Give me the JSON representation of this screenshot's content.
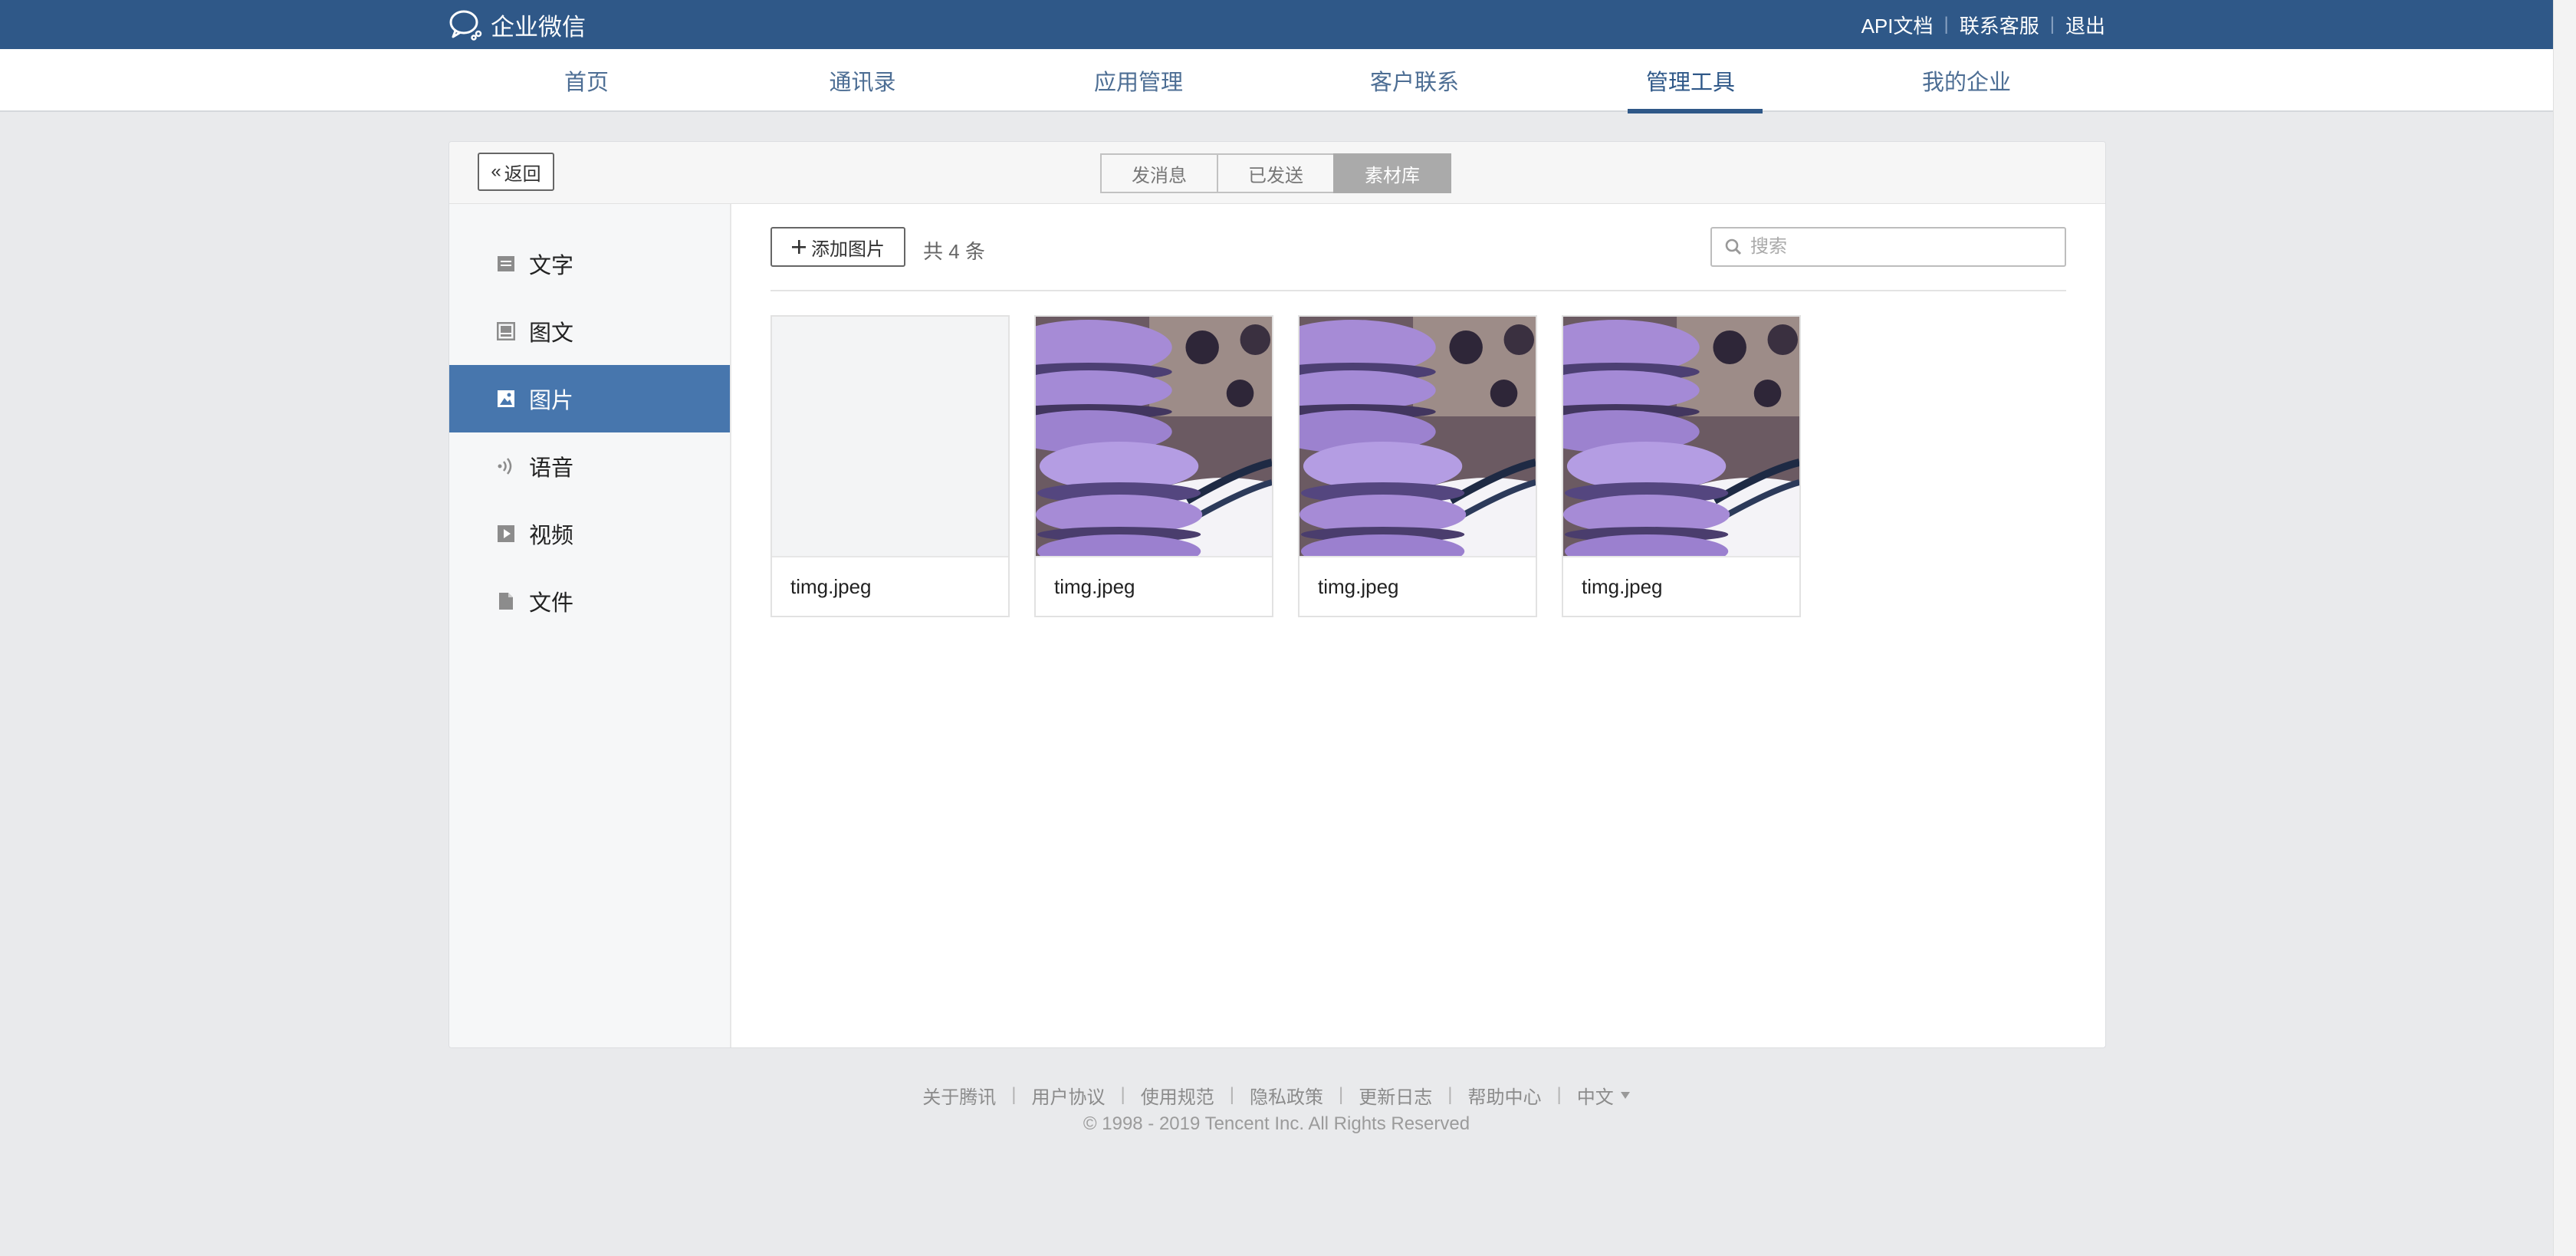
{
  "app": {
    "name": "企业微信"
  },
  "top_links": [
    "API文档",
    "联系客服",
    "退出"
  ],
  "nav": {
    "items": [
      "首页",
      "通讯录",
      "应用管理",
      "客户联系",
      "管理工具",
      "我的企业"
    ],
    "active": "管理工具"
  },
  "header": {
    "back_label": "返回",
    "tabs": [
      "发消息",
      "已发送",
      "素材库"
    ],
    "active_tab": "素材库"
  },
  "sidebar": {
    "items": [
      {
        "label": "文字",
        "icon": "text-doc-icon"
      },
      {
        "label": "图文",
        "icon": "article-icon"
      },
      {
        "label": "图片",
        "icon": "image-icon"
      },
      {
        "label": "语音",
        "icon": "voice-icon"
      },
      {
        "label": "视频",
        "icon": "video-icon"
      },
      {
        "label": "文件",
        "icon": "file-icon"
      }
    ],
    "active": "图片"
  },
  "toolbar": {
    "add_label": "添加图片",
    "count_text": "共 4 条",
    "search_placeholder": "搜索"
  },
  "images": [
    {
      "name": "timg.jpeg",
      "loaded": false
    },
    {
      "name": "timg.jpeg",
      "loaded": true
    },
    {
      "name": "timg.jpeg",
      "loaded": true
    },
    {
      "name": "timg.jpeg",
      "loaded": true
    }
  ],
  "footer": {
    "links": [
      "关于腾讯",
      "用户协议",
      "使用规范",
      "隐私政策",
      "更新日志",
      "帮助中心"
    ],
    "language": "中文",
    "copyright": "© 1998 - 2019 Tencent Inc. All Rights Reserved"
  },
  "colors": {
    "topbar": "#2f5888",
    "active_sidebar": "#4776ad",
    "macaron": "#a48ad6"
  }
}
